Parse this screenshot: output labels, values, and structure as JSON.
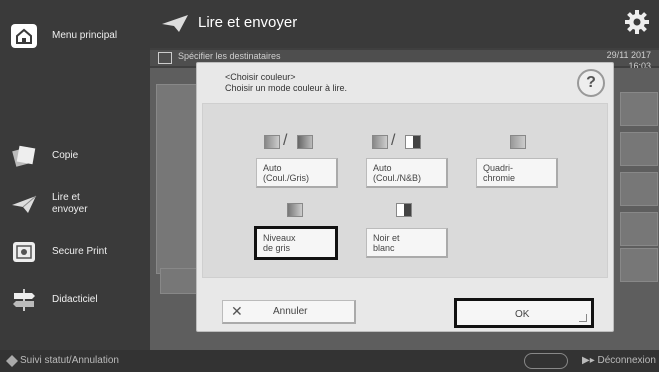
{
  "sidebar": {
    "menu_label": "Menu principal",
    "items": [
      {
        "label": "Copie"
      },
      {
        "label": "Lire et\nenvoyer"
      },
      {
        "label": "Secure Print"
      },
      {
        "label": "Didacticiel"
      }
    ]
  },
  "header": {
    "title": "Lire et envoyer"
  },
  "subbar": {
    "text": "Spécifier les destinataires",
    "date": "29/11 2017",
    "time": "16:03"
  },
  "dialog": {
    "title_line1": "<Choisir couleur>",
    "title_line2": "Choisir un mode couleur à lire.",
    "help_label": "?",
    "options": [
      {
        "line1": "Auto",
        "line2": "(Coul./Gris)"
      },
      {
        "line1": "Auto",
        "line2": "(Coul./N&B)"
      },
      {
        "line1": "Quadri-",
        "line2": "chromie"
      },
      {
        "line1": "Niveaux",
        "line2": "de gris"
      },
      {
        "line1": "Noir et",
        "line2": "blanc"
      }
    ],
    "cancel_label": "Annuler",
    "ok_label": "OK"
  },
  "bottombar": {
    "status_label": "Suivi statut/Annulation",
    "logout_label": "Déconnexion"
  }
}
